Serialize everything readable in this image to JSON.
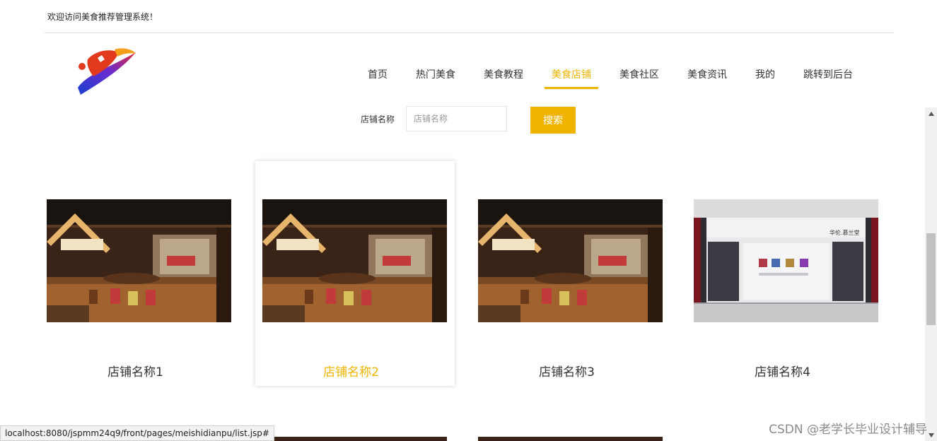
{
  "header": {
    "welcome": "欢迎访问美食推荐管理系统！"
  },
  "nav": {
    "items": [
      {
        "label": "首页"
      },
      {
        "label": "热门美食"
      },
      {
        "label": "美食教程"
      },
      {
        "label": "美食店铺",
        "active": true
      },
      {
        "label": "美食社区"
      },
      {
        "label": "美食资讯"
      },
      {
        "label": "我的"
      },
      {
        "label": "跳转到后台"
      }
    ]
  },
  "search": {
    "label": "店铺名称",
    "placeholder": "店铺名称",
    "value": "",
    "button": "搜索"
  },
  "shops": [
    {
      "name": "店铺名称1",
      "image": "restaurant-interior"
    },
    {
      "name": "店铺名称2",
      "image": "restaurant-interior"
    },
    {
      "name": "店铺名称3",
      "image": "restaurant-interior"
    },
    {
      "name": "店铺名称4",
      "image": "storefront"
    }
  ],
  "storefront_sign": "华伦.慕兰堂",
  "status_url": "localhost:8080/jspmm24q9/front/pages/meishidianpu/list.jsp#",
  "watermark": "CSDN @老学长毕业设计辅导",
  "colors": {
    "accent": "#f0b400",
    "text": "#333333"
  }
}
